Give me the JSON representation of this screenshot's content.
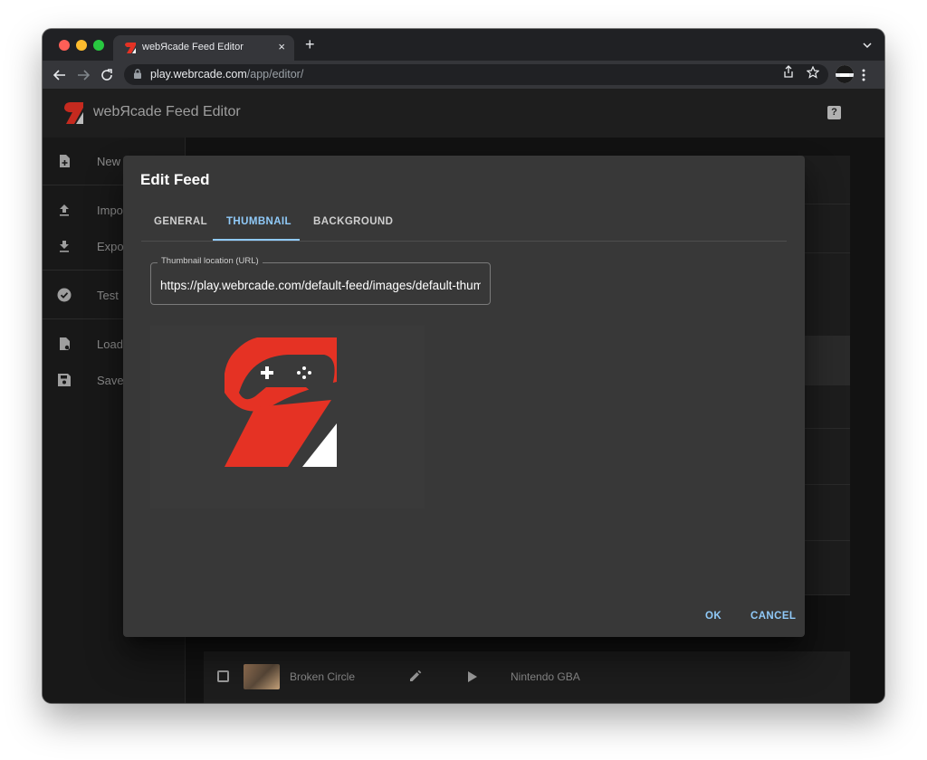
{
  "browser": {
    "tab_title": "webЯcade Feed Editor",
    "tab_close": "×",
    "new_tab": "+",
    "url_host": "play.webrcade.com",
    "url_path": "/app/editor/",
    "icons": [
      "back-arrow-icon",
      "forward-arrow-icon",
      "reload-icon",
      "lock-icon",
      "share-icon",
      "star-icon",
      "profile-avatar",
      "kebab-menu-icon",
      "tab-list-icon"
    ]
  },
  "app": {
    "title": "webЯcade Feed Editor",
    "help_label": "?",
    "brand_colors": {
      "red": "#e53224",
      "dark": "#3a3a3a",
      "white": "#ffffff"
    }
  },
  "sidebar": {
    "items": [
      {
        "label": "New",
        "icon": "new-file-icon"
      },
      {
        "label": "Import",
        "icon": "upload-icon"
      },
      {
        "label": "Export",
        "icon": "download-icon"
      },
      {
        "label": "Test",
        "icon": "check-circle-icon"
      },
      {
        "label": "Load",
        "icon": "load-file-icon"
      },
      {
        "label": "Save",
        "icon": "save-icon"
      }
    ]
  },
  "background_row": {
    "title": "Broken Circle",
    "type": "Nintendo GBA"
  },
  "dialog": {
    "title": "Edit Feed",
    "tabs": [
      {
        "label": "GENERAL",
        "active": false
      },
      {
        "label": "THUMBNAIL",
        "active": true
      },
      {
        "label": "BACKGROUND",
        "active": false
      }
    ],
    "thumbnail_field": {
      "label": "Thumbnail location (URL)",
      "value": "https://play.webrcade.com/default-feed/images/default-thumb.png"
    },
    "ok_label": "OK",
    "cancel_label": "CANCEL",
    "accent_color": "#90caf9"
  }
}
